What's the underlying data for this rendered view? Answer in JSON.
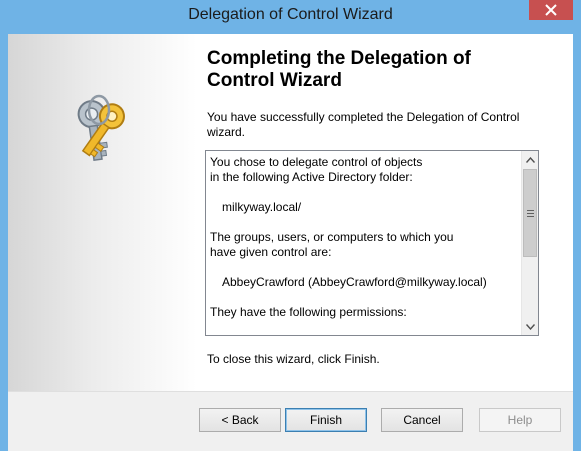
{
  "window": {
    "title": "Delegation of Control Wizard",
    "accent_color": "#6fb3e6",
    "close_color": "#c75050"
  },
  "sidebar": {
    "icon": "keys-icon"
  },
  "content": {
    "heading": "Completing the Delegation of Control Wizard",
    "intro": "You have successfully completed the Delegation of Control wizard.",
    "summary": {
      "line1": "You chose to delegate control of objects",
      "line2": "in the following Active Directory folder:",
      "folder": "milkyway.local/",
      "line3": "The groups, users, or computers to which you",
      "line4": "have given control are:",
      "principal": "AbbeyCrawford (AbbeyCrawford@milkyway.local)",
      "line5": "They have the following permissions:"
    },
    "close_note": "To close this wizard, click Finish."
  },
  "footer": {
    "back_label": "< Back",
    "finish_label": "Finish",
    "cancel_label": "Cancel",
    "help_label": "Help"
  }
}
